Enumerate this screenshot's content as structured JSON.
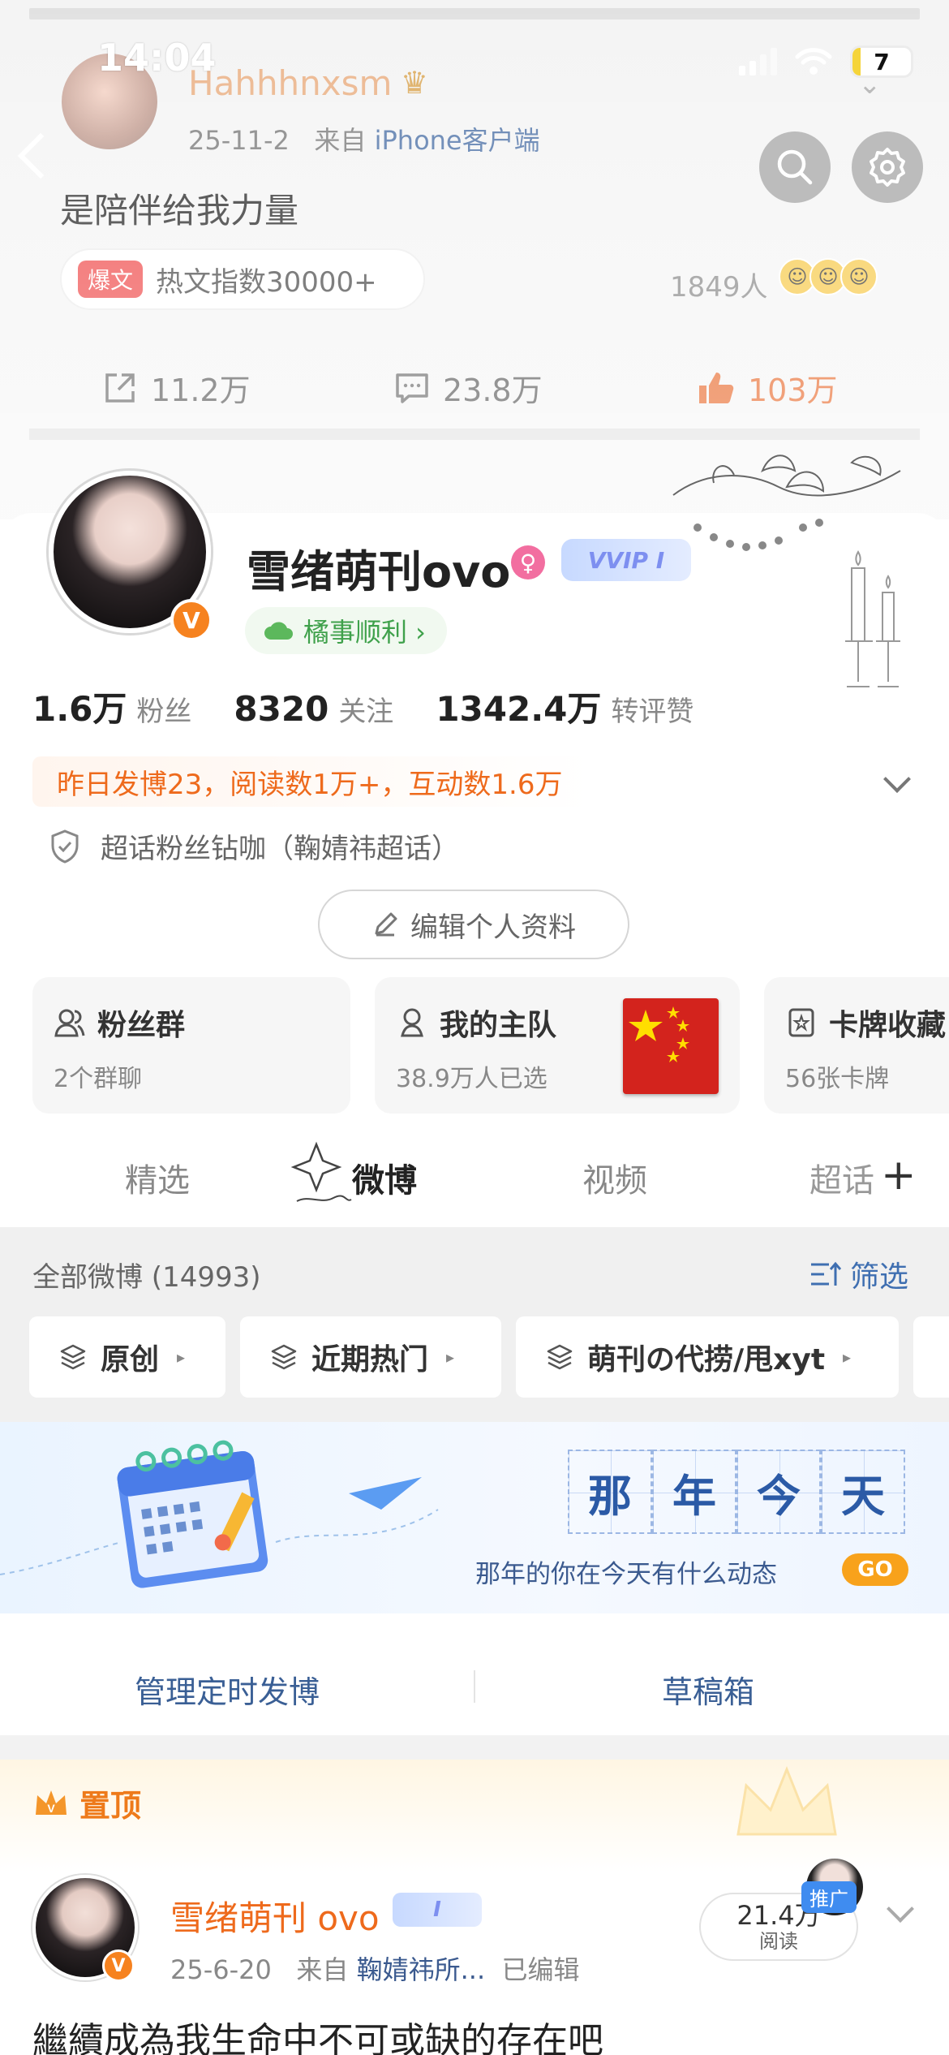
{
  "status_bar": {
    "time": "14:04",
    "battery": "7"
  },
  "prev_post": {
    "user_name": "Hahhhnxsm",
    "date": "25-11-2",
    "source_prefix": "来自",
    "source": "iPhone客户端",
    "text": "是陪伴给我力量",
    "hot_tag": "爆文",
    "hot_text": "热文指数30000+",
    "people": "1849人",
    "forwards": "11.2万",
    "comments": "23.8万",
    "likes": "103万"
  },
  "profile": {
    "name": "雪绪萌刊ovo",
    "vip_label": "VVIP I",
    "orange_luck": "橘事顺利 ›",
    "fans_num": "1.6万",
    "fans_label": "粉丝",
    "follow_num": "8320",
    "follow_label": "关注",
    "interact_num": "1342.4万",
    "interact_label": "转评赞",
    "yesterday": "昨日发博23，阅读数1万+，互动数1.6万",
    "supertopic": "超话粉丝钻咖（鞠婧祎超话）",
    "edit_label": "编辑个人资料"
  },
  "cards": [
    {
      "title": "粉丝群",
      "sub": "2个群聊"
    },
    {
      "title": "我的主队",
      "sub": "38.9万人已选"
    },
    {
      "title": "卡牌收藏",
      "sub": "56张卡牌"
    }
  ],
  "tabs": [
    "精选",
    "微博",
    "视频",
    "超话"
  ],
  "feed": {
    "all_label": "全部微博 (14993)",
    "filter_label": "筛选",
    "chips": [
      "原创",
      "近期热门",
      "萌刊の代捞/甩xyt"
    ]
  },
  "banner": {
    "chars": [
      "那",
      "年",
      "今",
      "天"
    ],
    "sub": "那年的你在今天有什么动态",
    "go": "GO"
  },
  "manage": {
    "left": "管理定时发博",
    "right": "草稿箱"
  },
  "pinned": {
    "label": "置顶",
    "user_name": "雪绪萌刊 ovo",
    "badge": "I",
    "date": "25-6-20",
    "source_prefix": "来自",
    "source": "鞠婧祎所...",
    "edited": "已编辑",
    "reads_num": "21.4万",
    "reads_label": "阅读",
    "promo": "推广",
    "text": "繼續成為我生命中不可或缺的存在吧"
  },
  "colors": {
    "accent_orange": "#ee6a1c",
    "link_blue": "#3a5f95",
    "green": "#3fa14b"
  }
}
